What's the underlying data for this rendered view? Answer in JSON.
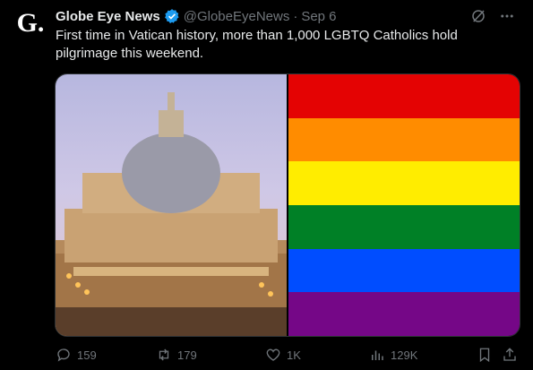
{
  "tweet": {
    "author_name": "Globe Eye News",
    "author_logo_letter": "G.",
    "handle": "@GlobeEyeNews",
    "separator": "·",
    "time": "Sep 6",
    "text": "First time in Vatican history, more than 1,000 LGBTQ Catholics hold pilgrimage this weekend."
  },
  "media": {
    "left_image": "st-peters-basilica-photo",
    "right_image": "rainbow-flag",
    "flag_colors": [
      "#e40303",
      "#ff8c00",
      "#ffed00",
      "#008026",
      "#004dff",
      "#750787"
    ]
  },
  "stats": {
    "replies": "159",
    "reposts": "179",
    "likes": "1K",
    "views": "129K"
  },
  "colors": {
    "background": "#000000",
    "text": "#e7e9ea",
    "muted": "#71767b",
    "verified": "#1d9bf0"
  }
}
